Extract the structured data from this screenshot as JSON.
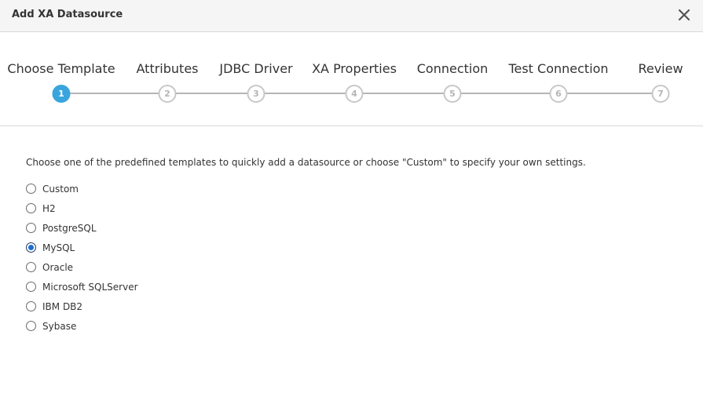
{
  "dialog": {
    "title": "Add XA Datasource",
    "close_icon": "close-icon"
  },
  "wizard": {
    "current_step": 1,
    "steps": [
      {
        "number": "1",
        "label": "Choose Template"
      },
      {
        "number": "2",
        "label": "Attributes"
      },
      {
        "number": "3",
        "label": "JDBC Driver"
      },
      {
        "number": "4",
        "label": "XA Properties"
      },
      {
        "number": "5",
        "label": "Connection"
      },
      {
        "number": "6",
        "label": "Test Connection"
      },
      {
        "number": "7",
        "label": "Review"
      }
    ],
    "colors": {
      "active": "#39a5dc",
      "inactive": "#c8c8c8"
    }
  },
  "main": {
    "instructions": "Choose one of the predefined templates to quickly add a datasource or choose \"Custom\" to specify your own settings.",
    "selected": "MySQL",
    "templates": [
      {
        "label": "Custom"
      },
      {
        "label": "H2"
      },
      {
        "label": "PostgreSQL"
      },
      {
        "label": "MySQL"
      },
      {
        "label": "Oracle"
      },
      {
        "label": "Microsoft SQLServer"
      },
      {
        "label": "IBM DB2"
      },
      {
        "label": "Sybase"
      }
    ]
  }
}
